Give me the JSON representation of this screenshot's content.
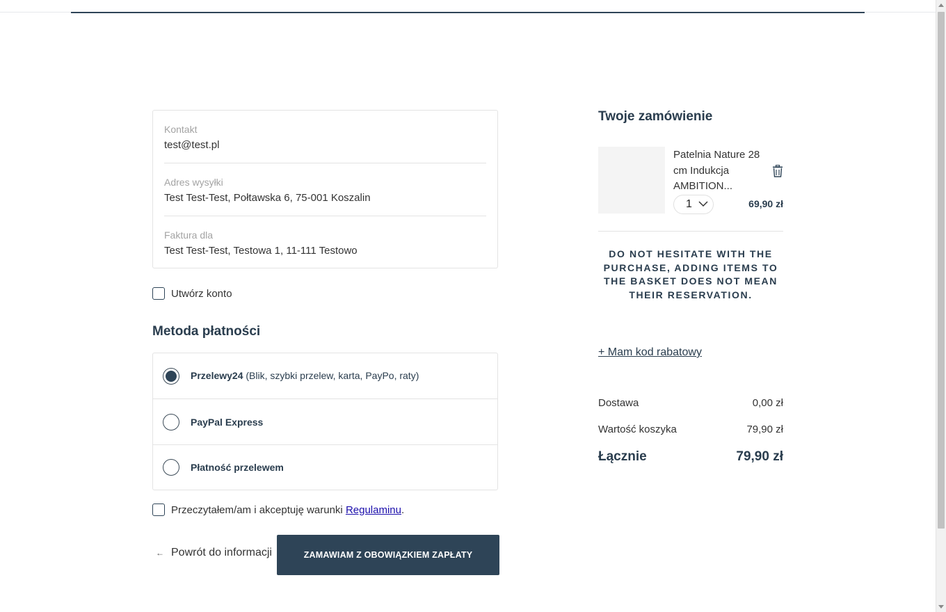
{
  "summary": {
    "contact_label": "Kontakt",
    "contact_value": "test@test.pl",
    "shipping_label": "Adres wysyłki",
    "shipping_value": "Test Test-Test, Połtawska 6, 75-001 Koszalin",
    "invoice_label": "Faktura dla",
    "invoice_value": "Test Test-Test, Testowa 1, 11-111 Testowo"
  },
  "create_account_label": "Utwórz konto",
  "payment": {
    "heading": "Metoda płatności",
    "options": [
      {
        "name": "Przelewy24",
        "desc": " (Blik, szybki przelew, karta, PayPo, raty)",
        "selected": true
      },
      {
        "name": "PayPal Express",
        "desc": "",
        "selected": false
      },
      {
        "name": "Płatność przelewem",
        "desc": "",
        "selected": false
      }
    ]
  },
  "terms": {
    "text": "Przeczytałem/am i akceptuję warunki ",
    "link": "Regulaminu",
    "suffix": "."
  },
  "actions": {
    "back_label": "Powrót do informacji",
    "back_icon": "arrow-left-icon",
    "submit_label": "ZAMAWIAM Z OBOWIĄZKIEM ZAPŁATY"
  },
  "order": {
    "title": "Twoje zamówienie",
    "item": {
      "name": "Patelnia Nature 28 cm Indukcja AMBITION...",
      "quantity": "1",
      "price": "69,90 zł"
    },
    "notice": "Do not hesitate with the purchase, adding items to the basket does not mean their reservation.",
    "discount_link": "+ Mam kod rabatowy",
    "shipping_label": "Dostawa",
    "shipping_value": "0,00 zł",
    "cart_label": "Wartość koszyka",
    "cart_value": "79,90 zł",
    "total_label": "Łącznie",
    "total_value": "79,90 zł"
  },
  "colors": {
    "accent": "#2e4457",
    "border": "#e3e3e3",
    "muted_label": "#a3a3a3",
    "link": "#1a0dab"
  }
}
